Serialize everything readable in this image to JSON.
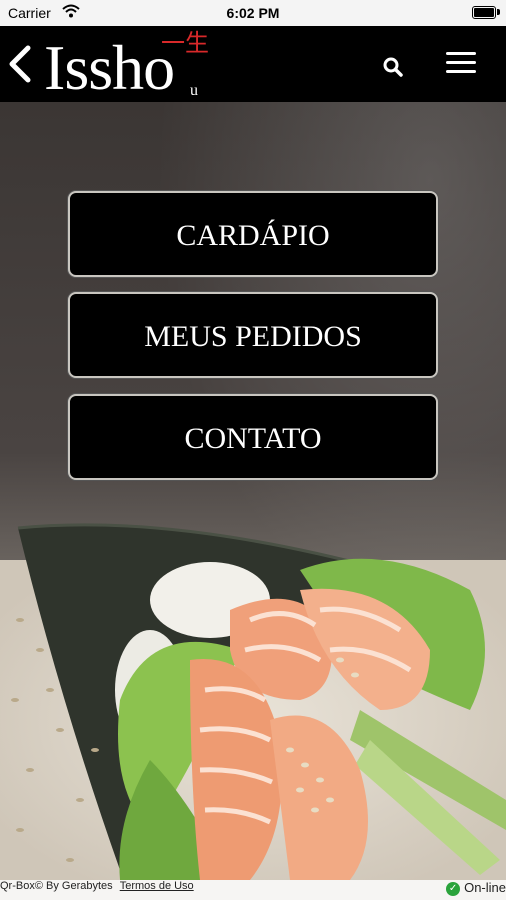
{
  "status_bar": {
    "carrier": "Carrier",
    "time": "6:02 PM"
  },
  "header": {
    "logo_main": "Issho",
    "logo_suffix": "u",
    "logo_kanji": "一生",
    "back_icon": "chevron-left-icon",
    "search_icon": "search-icon",
    "menu_icon": "hamburger-menu-icon"
  },
  "menu_buttons": [
    {
      "label": "CARDÁPIO"
    },
    {
      "label": "MEUS PEDIDOS"
    },
    {
      "label": "CONTATO"
    }
  ],
  "footer": {
    "credit": "Qr-Box© By Gerabytes",
    "terms_link": "Termos de Uso",
    "status": "On-line",
    "status_color": "#2aa33b"
  },
  "colors": {
    "header_bg": "#000000",
    "accent_red": "#d8292a",
    "button_bg": "#000000",
    "button_border": "#c9c6c0"
  }
}
